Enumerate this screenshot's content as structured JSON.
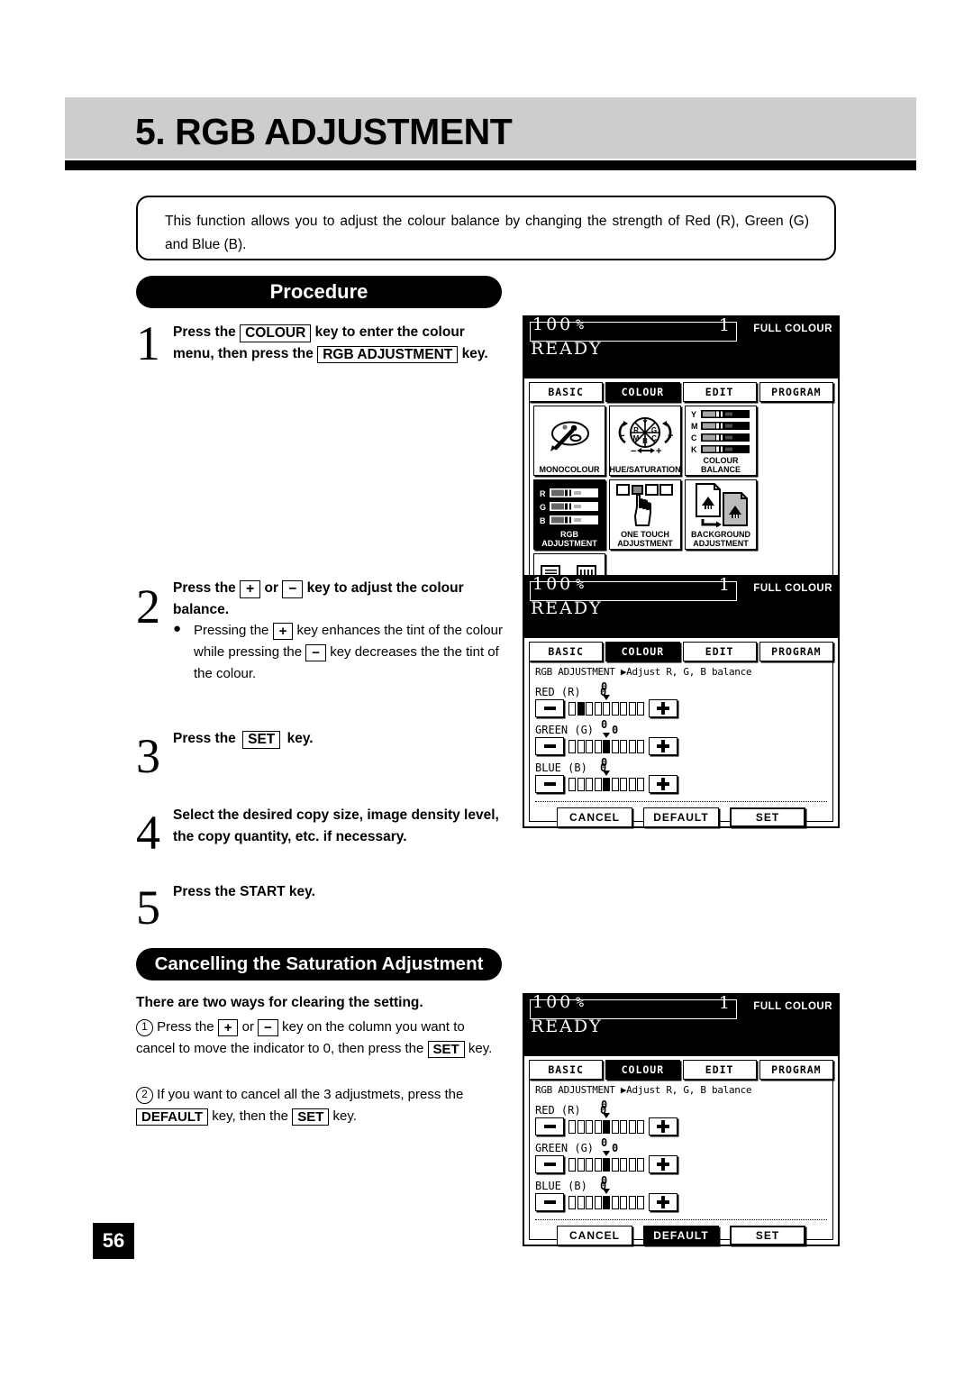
{
  "page": {
    "chapter_title": "5. RGB ADJUSTMENT",
    "page_number": "56",
    "intro": "This function allows you to adjust the colour balance by changing the strength of Red (R), Green (G) and Blue (B)."
  },
  "procedure": {
    "heading": "Procedure",
    "steps": [
      {
        "num": "1",
        "pre": "Press the",
        "key1": "COLOUR",
        "mid": "key to enter the colour menu, then press the",
        "key2": "RGB ADJUSTMENT",
        "post": "key."
      },
      {
        "num": "2",
        "pre": "Press the",
        "key1": "+",
        "mid": "or",
        "key2": "−",
        "post": "key to adjust the colour balance.",
        "bullet": {
          "a": "Pressing the",
          "key1": "+",
          "b": "key enhances the tint of the colour while pressing the",
          "key2": "−",
          "c": "key decreases the the tint of the colour."
        }
      },
      {
        "num": "3",
        "pre": "Press the",
        "key1": "SET",
        "post": "key."
      },
      {
        "num": "4",
        "text": "Select the desired copy size, image density level, the copy quantity, etc. if necessary."
      },
      {
        "num": "5",
        "text": "Press the START key."
      }
    ]
  },
  "cancelling": {
    "heading": "Cancelling the Saturation Adjustment",
    "lead": "There are two ways for clearing the setting.",
    "item1": {
      "marker": "1",
      "a": "Press the",
      "key1": "+",
      "b": "or",
      "key2": "−",
      "c": "key on the column you want to cancel to move the indicator to 0, then press the",
      "key3": "SET",
      "d": "key."
    },
    "item2": {
      "marker": "2",
      "a": "If you want to cancel all the 3 adjustmets, press the",
      "key1": "DEFAULT",
      "b": "key, then the",
      "key2": "SET",
      "c": "key."
    }
  },
  "lcd_common": {
    "zoom": "100",
    "percent": "%",
    "copies": "1",
    "mode": "FULL COLOUR",
    "status": "READY",
    "tabs": [
      {
        "label": "BASIC",
        "active": false
      },
      {
        "label": "COLOUR",
        "active": true
      },
      {
        "label": "EDIT",
        "active": false
      },
      {
        "label": "PROGRAM",
        "active": false
      }
    ]
  },
  "lcd_menu": {
    "icons": [
      {
        "name": "MONOCOLOUR",
        "icon": "palette-icon",
        "selected": false
      },
      {
        "name": "HUE/SATURATION",
        "icon": "colour-wheel-icon",
        "selected": false
      },
      {
        "name": "COLOUR BALANCE",
        "icon": "ymck-bars-icon",
        "selected": false,
        "rows": [
          "Y",
          "M",
          "C",
          "K"
        ]
      },
      {
        "name": "RGB ADJUSTMENT",
        "icon": "rgb-bars-icon",
        "selected": true,
        "rows": [
          "R",
          "G",
          "B"
        ],
        "caption_line1": "RGB",
        "caption_line2": "ADJUSTMENT"
      },
      {
        "name": "ONE TOUCH ADJUSTMENT",
        "icon": "hand-press-icon",
        "selected": false,
        "caption_line1": "ONE  TOUCH",
        "caption_line2": "ADJUSTMENT"
      },
      {
        "name": "BACKGROUND ADJUSTMENT",
        "icon": "document-pair-icon",
        "selected": false,
        "caption_line1": "BACKGROUND",
        "caption_line2": "ADJUSTMENT"
      },
      {
        "name": "SHARPNESS",
        "icon": "sharpness-icon",
        "selected": false
      }
    ],
    "wheel_letters": [
      "Y",
      "G",
      "C",
      "B",
      "M",
      "R"
    ],
    "wheel_minus": "−",
    "wheel_plus": "+"
  },
  "lcd_rgb_adjusted": {
    "breadcrumb": "RGB ADJUSTMENT ▶Adjust R, G, B balance",
    "minus_label": "−",
    "plus_label": "+",
    "scale_steps": 9,
    "zero_label": "0",
    "sliders": [
      {
        "label": "RED (R)",
        "value": "0",
        "position": 2
      },
      {
        "label": "GREEN (G)",
        "value": "0",
        "position": 5
      },
      {
        "label": "BLUE (B)",
        "value": "0",
        "position": 5
      }
    ],
    "buttons": [
      {
        "label": "CANCEL",
        "state": "normal"
      },
      {
        "label": "DEFAULT",
        "state": "normal"
      },
      {
        "label": "SET",
        "state": "selected"
      }
    ]
  },
  "lcd_rgb_default": {
    "breadcrumb": "RGB ADJUSTMENT ▶Adjust R, G, B balance",
    "minus_label": "−",
    "plus_label": "+",
    "scale_steps": 9,
    "zero_label": "0",
    "sliders": [
      {
        "label": "RED (R)",
        "value": "0",
        "position": 5
      },
      {
        "label": "GREEN (G)",
        "value": "0",
        "position": 5
      },
      {
        "label": "BLUE (B)",
        "value": "0",
        "position": 5
      }
    ],
    "buttons": [
      {
        "label": "CANCEL",
        "state": "normal"
      },
      {
        "label": "DEFAULT",
        "state": "inverted"
      },
      {
        "label": "SET",
        "state": "selected"
      }
    ]
  }
}
